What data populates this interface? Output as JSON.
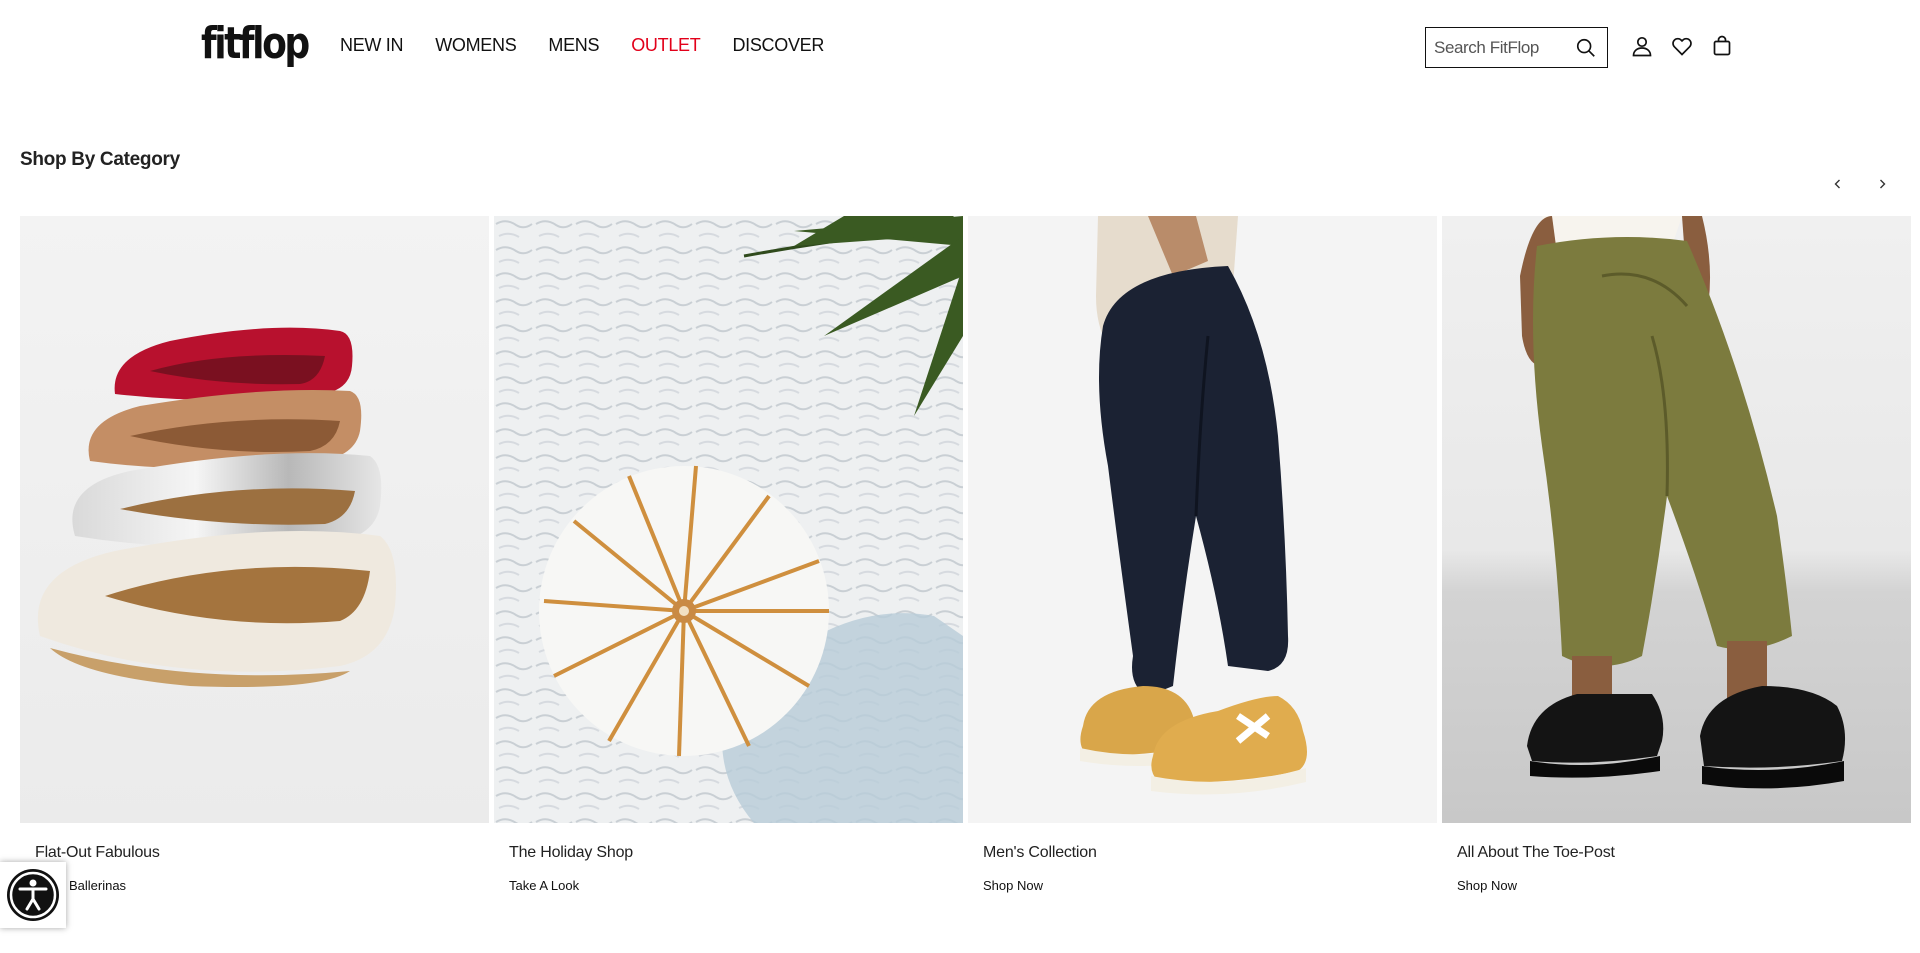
{
  "brand": {
    "logo_text": "fitflop"
  },
  "nav": {
    "items": [
      {
        "label": "NEW IN"
      },
      {
        "label": "WOMENS"
      },
      {
        "label": "MENS"
      },
      {
        "label": "OUTLET",
        "color": "#e2001a"
      },
      {
        "label": "DISCOVER"
      }
    ]
  },
  "search": {
    "placeholder": "Search FitFlop",
    "value": ""
  },
  "header_icons": [
    "user-icon",
    "heart-icon",
    "shopping-bag-icon"
  ],
  "section": {
    "title": "Shop By Category",
    "cards": [
      {
        "title": "Flat-Out Fabulous",
        "link": "Shop Ballerinas",
        "image": "ballerina-flats"
      },
      {
        "title": "The Holiday Shop",
        "link": "Take A Look",
        "image": "beach-umbrella"
      },
      {
        "title": "Men's Collection",
        "link": "Shop Now",
        "image": "mens-sneakers"
      },
      {
        "title": "All About The Toe-Post",
        "link": "Shop Now",
        "image": "toe-post-platform"
      }
    ]
  },
  "colors": {
    "accent": "#e2001a",
    "text": "#111111"
  }
}
